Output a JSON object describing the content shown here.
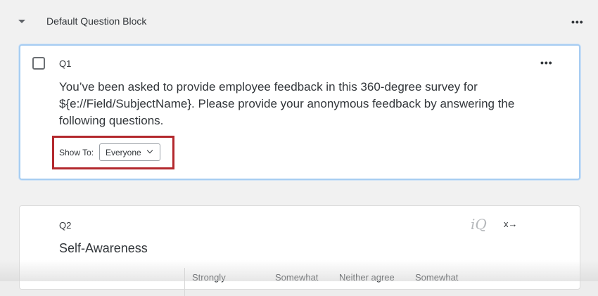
{
  "block": {
    "title": "Default Question Block",
    "menu": "•••"
  },
  "q1": {
    "id": "Q1",
    "menu": "•••",
    "text": "You’ve been asked to provide employee feedback in this 360-degree survey for ${e://Field/SubjectName}. Please provide your anonymous feedback by answering the following questions.",
    "show_to_label": "Show To:",
    "show_to_value": "Everyone"
  },
  "q2": {
    "id": "Q2",
    "iq_icon": "iQ",
    "recode_icon": "x→",
    "title": "Self-Awareness",
    "columns": [
      "Strongly",
      "Somewhat",
      "Neither agree",
      "Somewhat"
    ]
  },
  "colors": {
    "highlight": "#b3282d",
    "selected_border": "#a7cdf2"
  }
}
